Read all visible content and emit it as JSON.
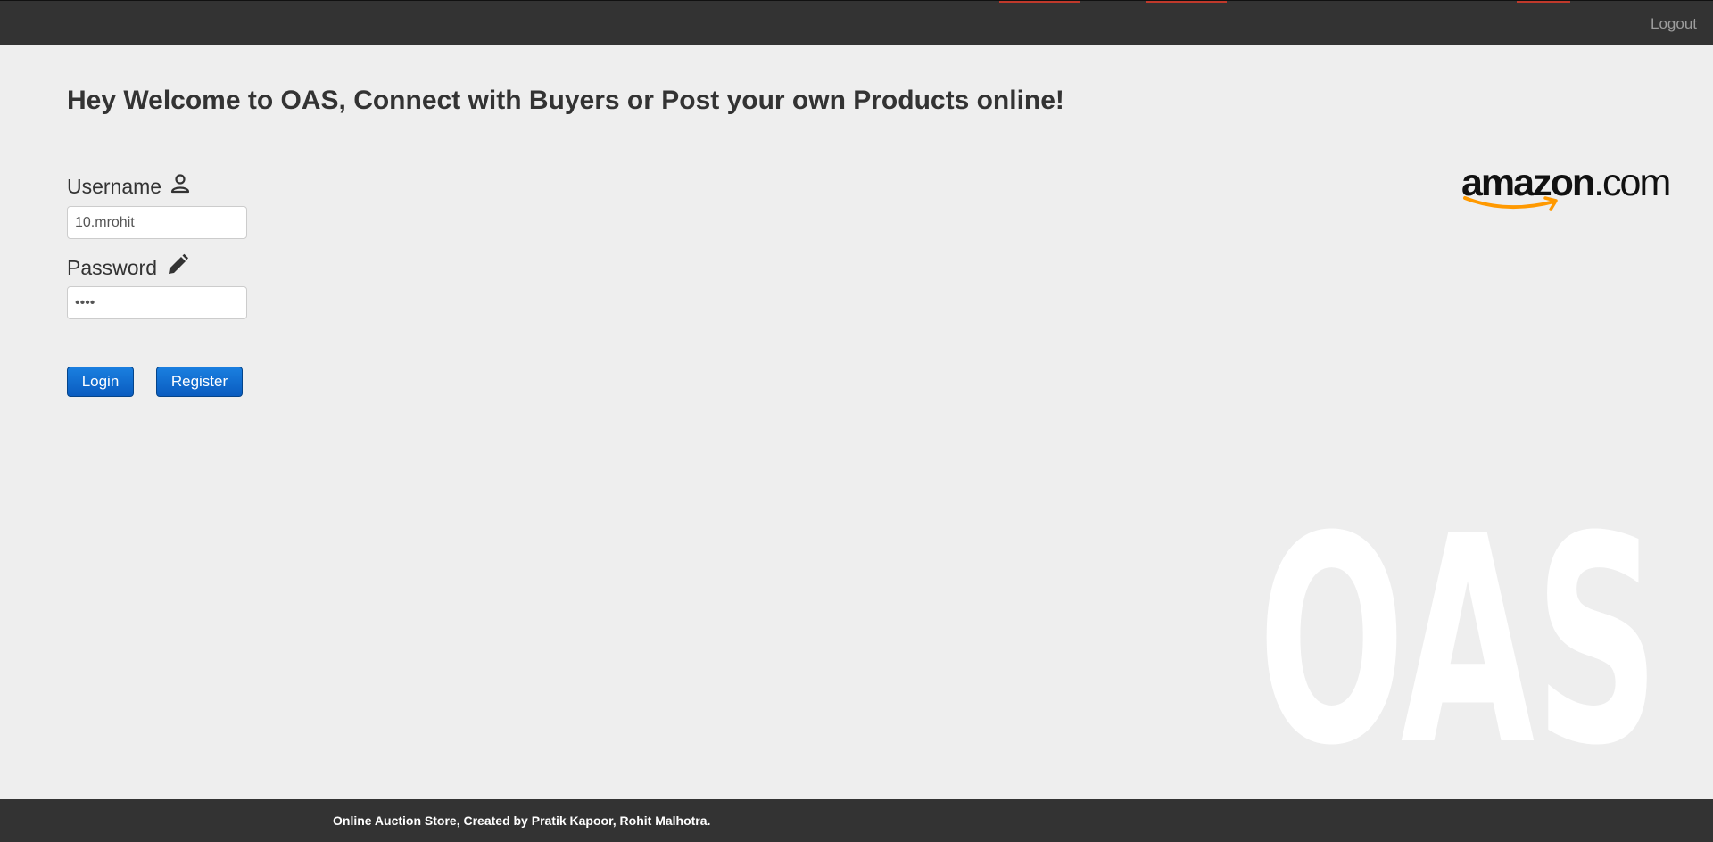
{
  "nav": {
    "logout_label": "Logout"
  },
  "welcome": {
    "heading": "Hey Welcome to OAS, Connect with Buyers or Post your own Products online!"
  },
  "login_form": {
    "username_label": "Username",
    "username_value": "10.mrohit",
    "password_label": "Password",
    "password_value": "mroh",
    "login_label": "Login",
    "register_label": "Register"
  },
  "branding": {
    "amazon_logo_text": "amazon",
    "amazon_logo_suffix": ".com",
    "watermark_text": "OAS"
  },
  "footer": {
    "credits": "Online Auction Store, Created by Pratik Kapoor, Rohit Malhotra."
  },
  "icons": {
    "username": "person-icon",
    "password": "pencil-icon"
  },
  "colors": {
    "navbar": "#333333",
    "page_background": "#eeeeee",
    "button_primary": "#0a5cc0",
    "amazon_orange": "#f90"
  }
}
